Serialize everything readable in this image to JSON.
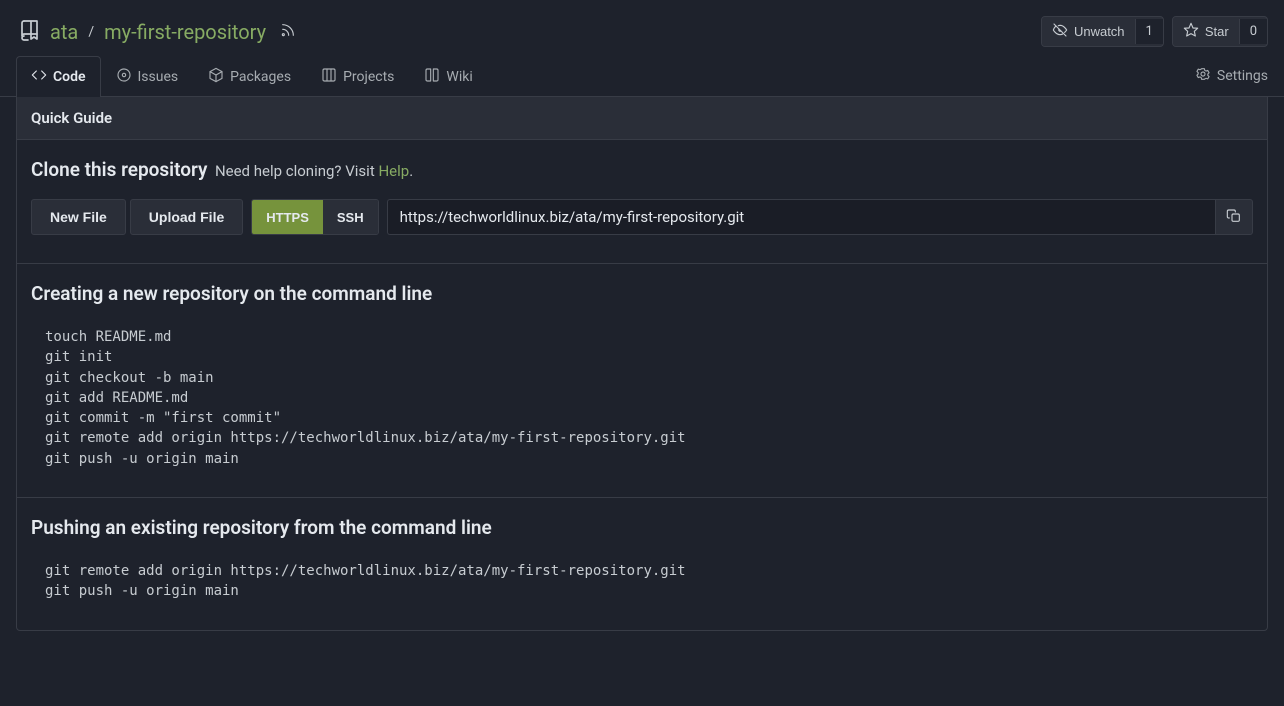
{
  "repo": {
    "owner": "ata",
    "name": "my-first-repository"
  },
  "actions": {
    "watch_label": "Unwatch",
    "watch_count": "1",
    "star_label": "Star",
    "star_count": "0"
  },
  "tabs": {
    "code": "Code",
    "issues": "Issues",
    "packages": "Packages",
    "projects": "Projects",
    "wiki": "Wiki",
    "settings": "Settings"
  },
  "guide": {
    "header": "Quick Guide",
    "clone_title": "Clone this repository",
    "clone_sub_pre": "Need help cloning? Visit ",
    "clone_sub_link": "Help",
    "clone_sub_post": ".",
    "new_file": "New File",
    "upload_file": "Upload File",
    "proto_https": "HTTPS",
    "proto_ssh": "SSH",
    "clone_url": "https://techworldlinux.biz/ata/my-first-repository.git",
    "sec1_title": "Creating a new repository on the command line",
    "sec1_code": "touch README.md\ngit init\ngit checkout -b main\ngit add README.md\ngit commit -m \"first commit\"\ngit remote add origin https://techworldlinux.biz/ata/my-first-repository.git\ngit push -u origin main",
    "sec2_title": "Pushing an existing repository from the command line",
    "sec2_code": "git remote add origin https://techworldlinux.biz/ata/my-first-repository.git\ngit push -u origin main"
  }
}
